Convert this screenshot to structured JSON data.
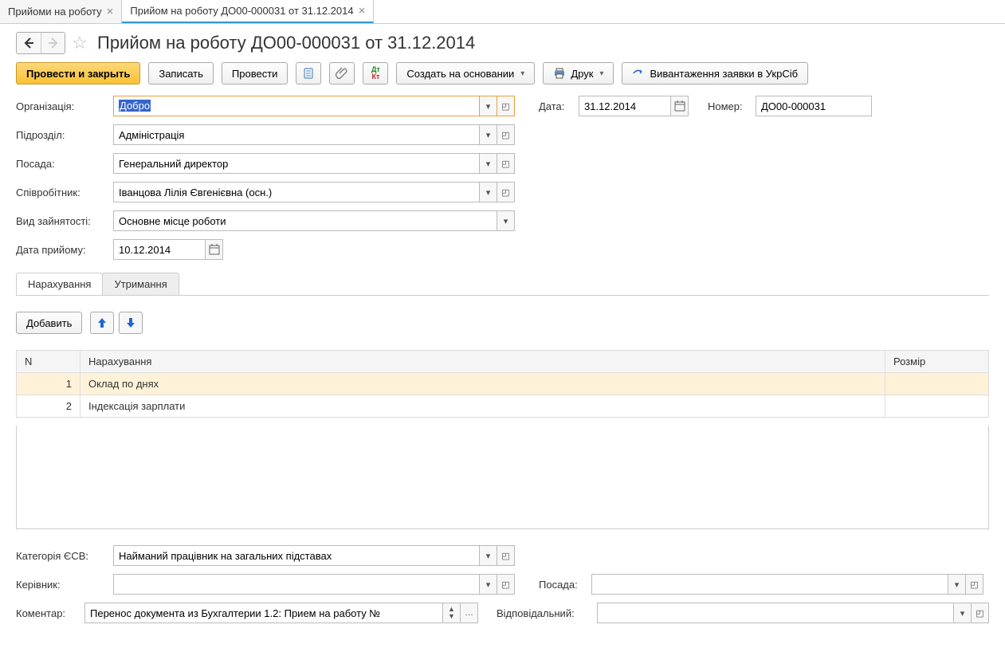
{
  "tabs": [
    {
      "label": "Прийоми на роботу"
    },
    {
      "label": "Прийом на роботу ДО00-000031 от 31.12.2014"
    }
  ],
  "title": "Прийом на роботу ДО00-000031 от 31.12.2014",
  "toolbar": {
    "post_and_close": "Провести и закрыть",
    "save": "Записать",
    "post": "Провести",
    "create_based": "Создать на основании",
    "print": "Друк",
    "export": "Вивантаження заявки в УкрСіб"
  },
  "labels": {
    "organization": "Організація:",
    "date": "Дата:",
    "number": "Номер:",
    "department": "Підрозділ:",
    "position": "Посада:",
    "employee": "Співробітник:",
    "employment_type": "Вид зайнятості:",
    "hire_date": "Дата прийому:",
    "category_esv": "Категорія ЄСВ:",
    "manager": "Керівник:",
    "position2": "Посада:",
    "comment": "Коментар:",
    "responsible": "Відповідальний:"
  },
  "values": {
    "organization": "Добро",
    "date": "31.12.2014",
    "number": "ДО00-000031",
    "department": "Адміністрація",
    "position": "Генеральний директор",
    "employee": "Іванцова Лілія Євгенієвна (осн.)",
    "employment_type": "Основне місце роботи",
    "hire_date": "10.12.2014",
    "category_esv": "Найманий працівник на загальних підставах",
    "manager": "",
    "position2": "",
    "comment": "Перенос документа из Бухгалтерии 1.2: Прием на работу №",
    "responsible": ""
  },
  "inner_tabs": {
    "accruals": "Нарахування",
    "deductions": "Утримання"
  },
  "table_toolbar": {
    "add": "Добавить"
  },
  "table": {
    "headers": {
      "n": "N",
      "accrual": "Нарахування",
      "size": "Розмір"
    },
    "rows": [
      {
        "n": "1",
        "accrual": "Оклад по днях",
        "size": ""
      },
      {
        "n": "2",
        "accrual": "Індексація зарплати",
        "size": ""
      }
    ]
  }
}
